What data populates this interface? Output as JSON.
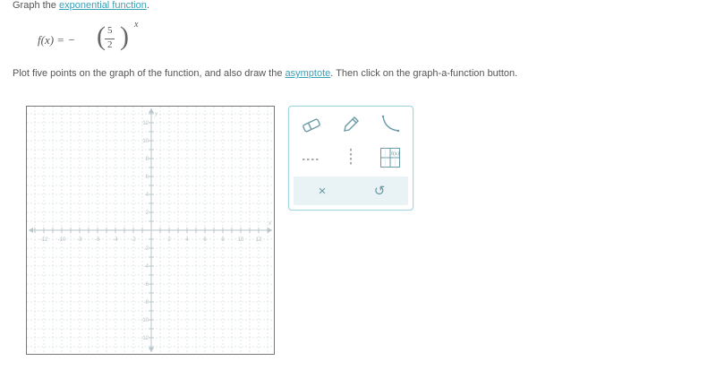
{
  "question": {
    "prefix": "Graph the ",
    "link": "exponential function",
    "suffix": "."
  },
  "formula": {
    "lhs": "f(x) = −",
    "numerator": "5",
    "denominator": "2",
    "exponent": "x"
  },
  "instructions": {
    "part1": "Plot five points on the graph of the function, and also draw the ",
    "link": "asymptote",
    "part2": ". Then click on the graph-a-function button."
  },
  "graph": {
    "x_label": "x",
    "y_label": "y",
    "x_ticks": [
      "-12",
      "-10",
      "-8",
      "-6",
      "-4",
      "-2",
      "2",
      "4",
      "6",
      "8",
      "10",
      "12"
    ],
    "y_ticks": [
      "12",
      "10",
      "8",
      "6",
      "4",
      "2",
      "-2",
      "-4",
      "-6",
      "-8",
      "-10",
      "-12"
    ]
  },
  "toolbox": {
    "tools": [
      "eraser-icon",
      "pencil-icon",
      "curve-icon",
      "dashed-line-icon",
      "vertical-dashed-line-icon",
      "graph-function-icon"
    ],
    "graph_function_icon_label": "f(x)",
    "clear_symbol": "×",
    "undo_symbol": "↺"
  },
  "colors": {
    "accent": "#3aa0b5",
    "tool_icon": "#6a9aa6",
    "toolbox_border": "#9fd4de",
    "action_bar": "#e9f2f5"
  }
}
